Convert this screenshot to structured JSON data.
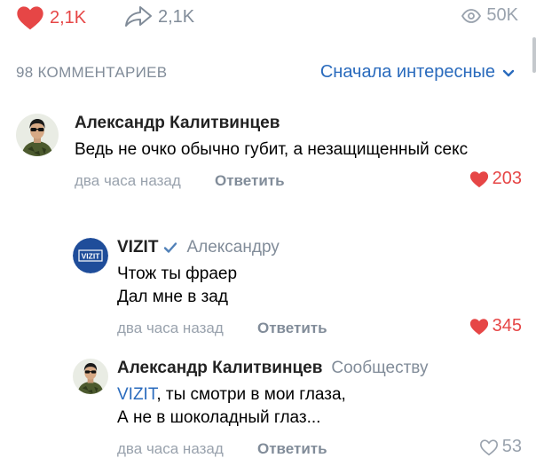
{
  "post": {
    "likes": "2,1K",
    "shares": "2,1K",
    "views": "50K"
  },
  "comments_header": {
    "count_label": "98 КОММЕНТАРИЕВ",
    "sort_label": "Сначала интересные"
  },
  "comments": [
    {
      "author": "Александр Калитвинцев",
      "reply_to": "",
      "text": "Ведь не очко обычно губит, а незащищенный секс",
      "time": "два часа назад",
      "reply_label": "Ответить",
      "likes": "203"
    },
    {
      "author": "VIZIT",
      "avatar_text": "VIZIT",
      "reply_to": "Александру",
      "line1": "Чтож ты фраер",
      "line2": "Дал мне в зад",
      "time": "два часа назад",
      "reply_label": "Ответить",
      "likes": "345"
    },
    {
      "author": "Александр Калитвинцев",
      "reply_to": "Сообществу",
      "mention": "VIZIT",
      "line1_rest": ", ты смотри в мои глаза,",
      "line2": "А не в шоколадный глаз...",
      "time": "два часа назад",
      "reply_label": "Ответить",
      "likes": "53"
    }
  ],
  "colors": {
    "like_red": "#e64646",
    "link_blue": "#2a6bbd",
    "secondary_gray": "#818c99",
    "vizit_blue": "#1f4d9a"
  },
  "icons": [
    "heart-filled-icon",
    "share-arrow-icon",
    "eye-icon",
    "chevron-down-icon",
    "verified-check-icon",
    "heart-outline-icon"
  ]
}
